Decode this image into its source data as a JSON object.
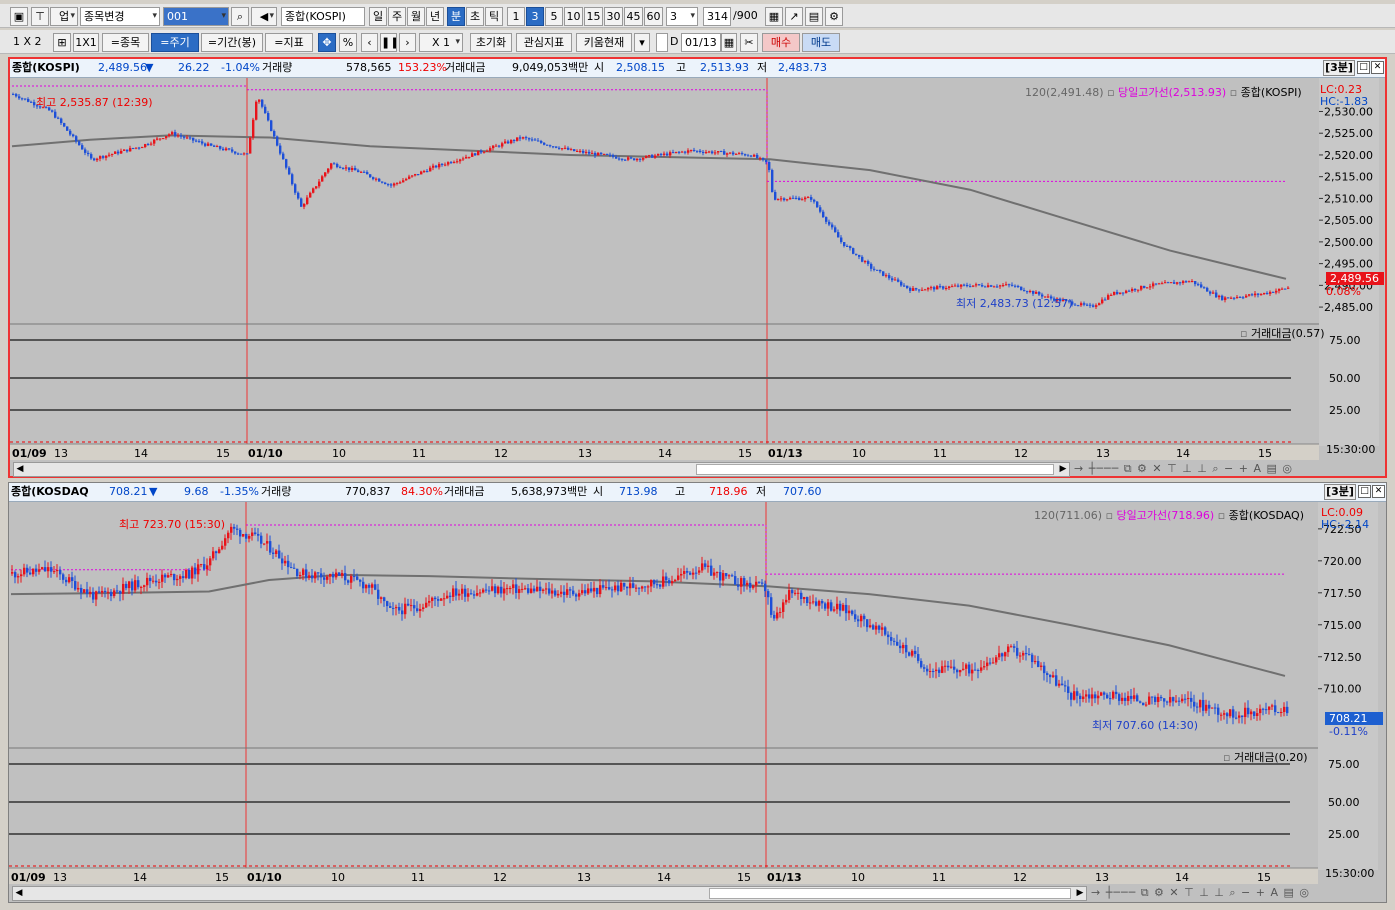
{
  "toolbar1": {
    "market_select": "업",
    "change_item": "종목변경",
    "code_input": "001",
    "name_display": "종합(KOSPI)",
    "period_buttons": [
      "일",
      "주",
      "월",
      "년",
      "분",
      "초",
      "틱"
    ],
    "interval_buttons": [
      "1",
      "3",
      "5",
      "10",
      "15",
      "30",
      "45",
      "60"
    ],
    "interval_value": "3",
    "count_display": "314",
    "count_total": "/900"
  },
  "toolbar2": {
    "layout_label": "1 X 2",
    "one_by_one": "1X1",
    "item_label": "=종목",
    "period_label": "=주기",
    "range_label": "=기간(봉)",
    "indicator_label": "=지표",
    "percent": "%",
    "multiplier": "X 1",
    "reset": "초기화",
    "watch_indicator": "관심지표",
    "kiwoom": "키움현재",
    "d_label": "D",
    "date": "01/13",
    "buy": "매수",
    "sell": "매도"
  },
  "kospi": {
    "name": "종합(KOSPI)",
    "price": "2,489.56",
    "arrow": "▼",
    "change": "26.22",
    "change_pct": "-1.04%",
    "volume_label": "거래량",
    "volume": "578,565",
    "volume_pct": "153.23%",
    "amount_label": "거래대금",
    "amount": "9,049,053백만",
    "open_label": "시",
    "open": "2,508.15",
    "high_label": "고",
    "high": "2,513.93",
    "low_label": "저",
    "low": "2,483.73",
    "interval_tag": "[3분]",
    "legend_ma": "120(2,491.48)",
    "legend_high_line": "당일고가선(2,513.93)",
    "legend_name": "종합(KOSPI)",
    "lc": "LC:0.23",
    "hc": "HC:-1.83",
    "high_annot": "최고 2,535.87 (12:39)",
    "low_annot": "최저 2,483.73 (12:57)",
    "last_price_tag": "2,489.56",
    "last_pct_tag": "0.08%",
    "price_ticks": [
      "2,530.00",
      "2,525.00",
      "2,520.00",
      "2,515.00",
      "2,510.00",
      "2,505.00",
      "2,500.00",
      "2,495.00",
      "2,490.00",
      "2,485.00"
    ],
    "sub_legend": "거래대금(0.57)",
    "sub_ticks": [
      "75.00",
      "50.00",
      "25.00"
    ]
  },
  "kosdaq": {
    "name": "종합(KOSDAQ",
    "price": "708.21",
    "arrow": "▼",
    "change": "9.68",
    "change_pct": "-1.35%",
    "volume_label": "거래량",
    "volume": "770,837",
    "volume_pct": "84.30%",
    "amount_label": "거래대금",
    "amount": "5,638,973백만",
    "open_label": "시",
    "open": "713.98",
    "high_label": "고",
    "high": "718.96",
    "low_label": "저",
    "low": "707.60",
    "interval_tag": "[3분]",
    "legend_ma": "120(711.06)",
    "legend_high_line": "당일고가선(718.96)",
    "legend_name": "종합(KOSDAQ)",
    "lc": "LC:0.09",
    "hc": "HC:-2.14",
    "high_annot": "최고 723.70 (15:30)",
    "low_annot": "최저 707.60 (14:30)",
    "last_price_tag": "708.21",
    "last_pct_tag": "-0.11%",
    "price_ticks": [
      "722.50",
      "720.00",
      "717.50",
      "715.00",
      "712.50",
      "710.00"
    ],
    "sub_legend": "거래대금(0.20)",
    "sub_ticks": [
      "75.00",
      "50.00",
      "25.00"
    ]
  },
  "x_axis": {
    "labels": [
      "01/09",
      "13",
      "14",
      "15",
      "01/10",
      "10",
      "11",
      "12",
      "13",
      "14",
      "15",
      "01/13",
      "10",
      "11",
      "12",
      "13",
      "14",
      "15"
    ],
    "end_time": "15:30:00"
  },
  "colors": {
    "up": "#e8131a",
    "down": "#1d4fd8",
    "ma": "#707070",
    "high_line": "#e000e0",
    "session_line": "#e33"
  }
}
